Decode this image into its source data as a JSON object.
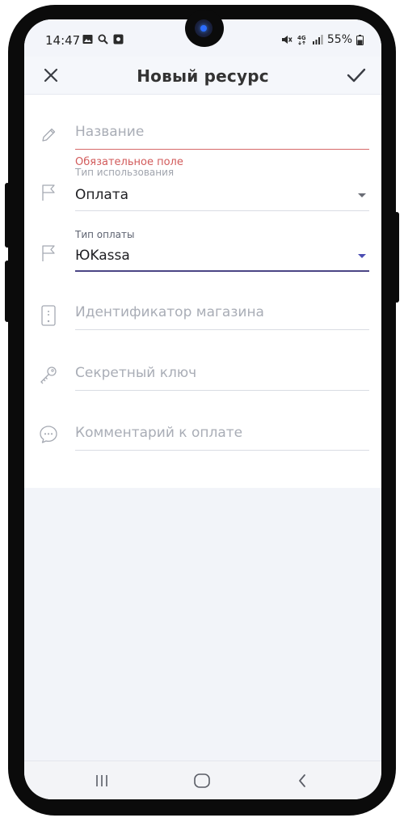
{
  "status_bar": {
    "time": "14:47",
    "left_icons": [
      "gallery-icon",
      "search-icon",
      "app-notification-icon"
    ],
    "right_icons": [
      "mute-icon",
      "4g-icon",
      "signal-icon"
    ],
    "battery": "55%"
  },
  "app_bar": {
    "title": "Новый ресурс",
    "close_icon": "close-icon",
    "confirm_icon": "check-icon"
  },
  "form": {
    "name": {
      "placeholder": "Название",
      "error": "Обязательное поле",
      "icon": "pencil-icon"
    },
    "usage_type": {
      "label": "Тип использования",
      "value": "Оплата",
      "icon": "flag-icon"
    },
    "payment_type": {
      "label": "Тип оплаты",
      "value": "ЮKassa",
      "icon": "flag-icon"
    },
    "shop_id": {
      "placeholder": "Идентификатор магазина",
      "icon": "device-icon"
    },
    "secret_key": {
      "placeholder": "Секретный ключ",
      "icon": "key-icon"
    },
    "payment_comment": {
      "placeholder": "Комментарий к оплате",
      "icon": "comment-icon"
    }
  },
  "nav_bar": [
    "recent-apps-icon",
    "home-icon",
    "back-icon"
  ],
  "colors": {
    "error": "#d25b5b",
    "accent": "#4b4585",
    "dropdown_active": "#4b4db3"
  }
}
